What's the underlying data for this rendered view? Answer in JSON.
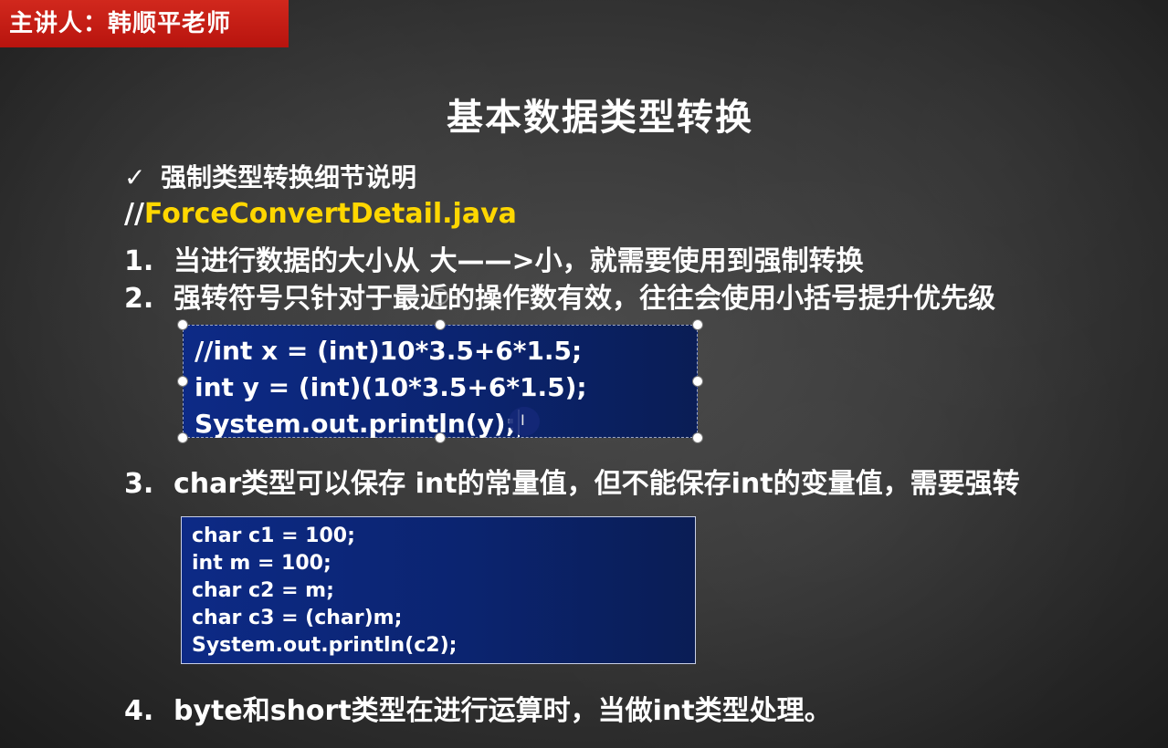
{
  "presenter_label": "主讲人：韩顺平老师",
  "title": "基本数据类型转换",
  "subheading": {
    "check": "✓",
    "text": "强制类型转换细节说明"
  },
  "filename": {
    "slashes": "//",
    "name": "ForceConvertDetail.java"
  },
  "points": [
    {
      "num": "1.",
      "text": "当进行数据的大小从 大——>小，就需要使用到强制转换"
    },
    {
      "num": "2.",
      "text": "强转符号只针对于最近的操作数有效，往往会使用小括号提升优先级"
    },
    {
      "num": "3.",
      "text": "char类型可以保存 int的常量值，但不能保存int的变量值，需要强转"
    },
    {
      "num": "4.",
      "text": "byte和short类型在进行运算时，当做int类型处理。"
    }
  ],
  "code_block_1": [
    "//int x = (int)10*3.5+6*1.5;",
    "int y = (int)(10*3.5+6*1.5);",
    "System.out.println(y);"
  ],
  "code_block_2": [
    "char c1 = 100;",
    "int m = 100;",
    "char c2 = m;",
    "char c3 = (char)m;",
    "System.out.println(c2);"
  ],
  "icons": {
    "cursor": "text-cursor-icon",
    "ibeam": "ibeam-pointer-icon",
    "check": "checkmark-icon"
  },
  "colors": {
    "presenter_bg": "#c81d15",
    "filename_accent": "#ffd700",
    "code_bg": "#0b2470"
  },
  "cursor_glyph": "I"
}
